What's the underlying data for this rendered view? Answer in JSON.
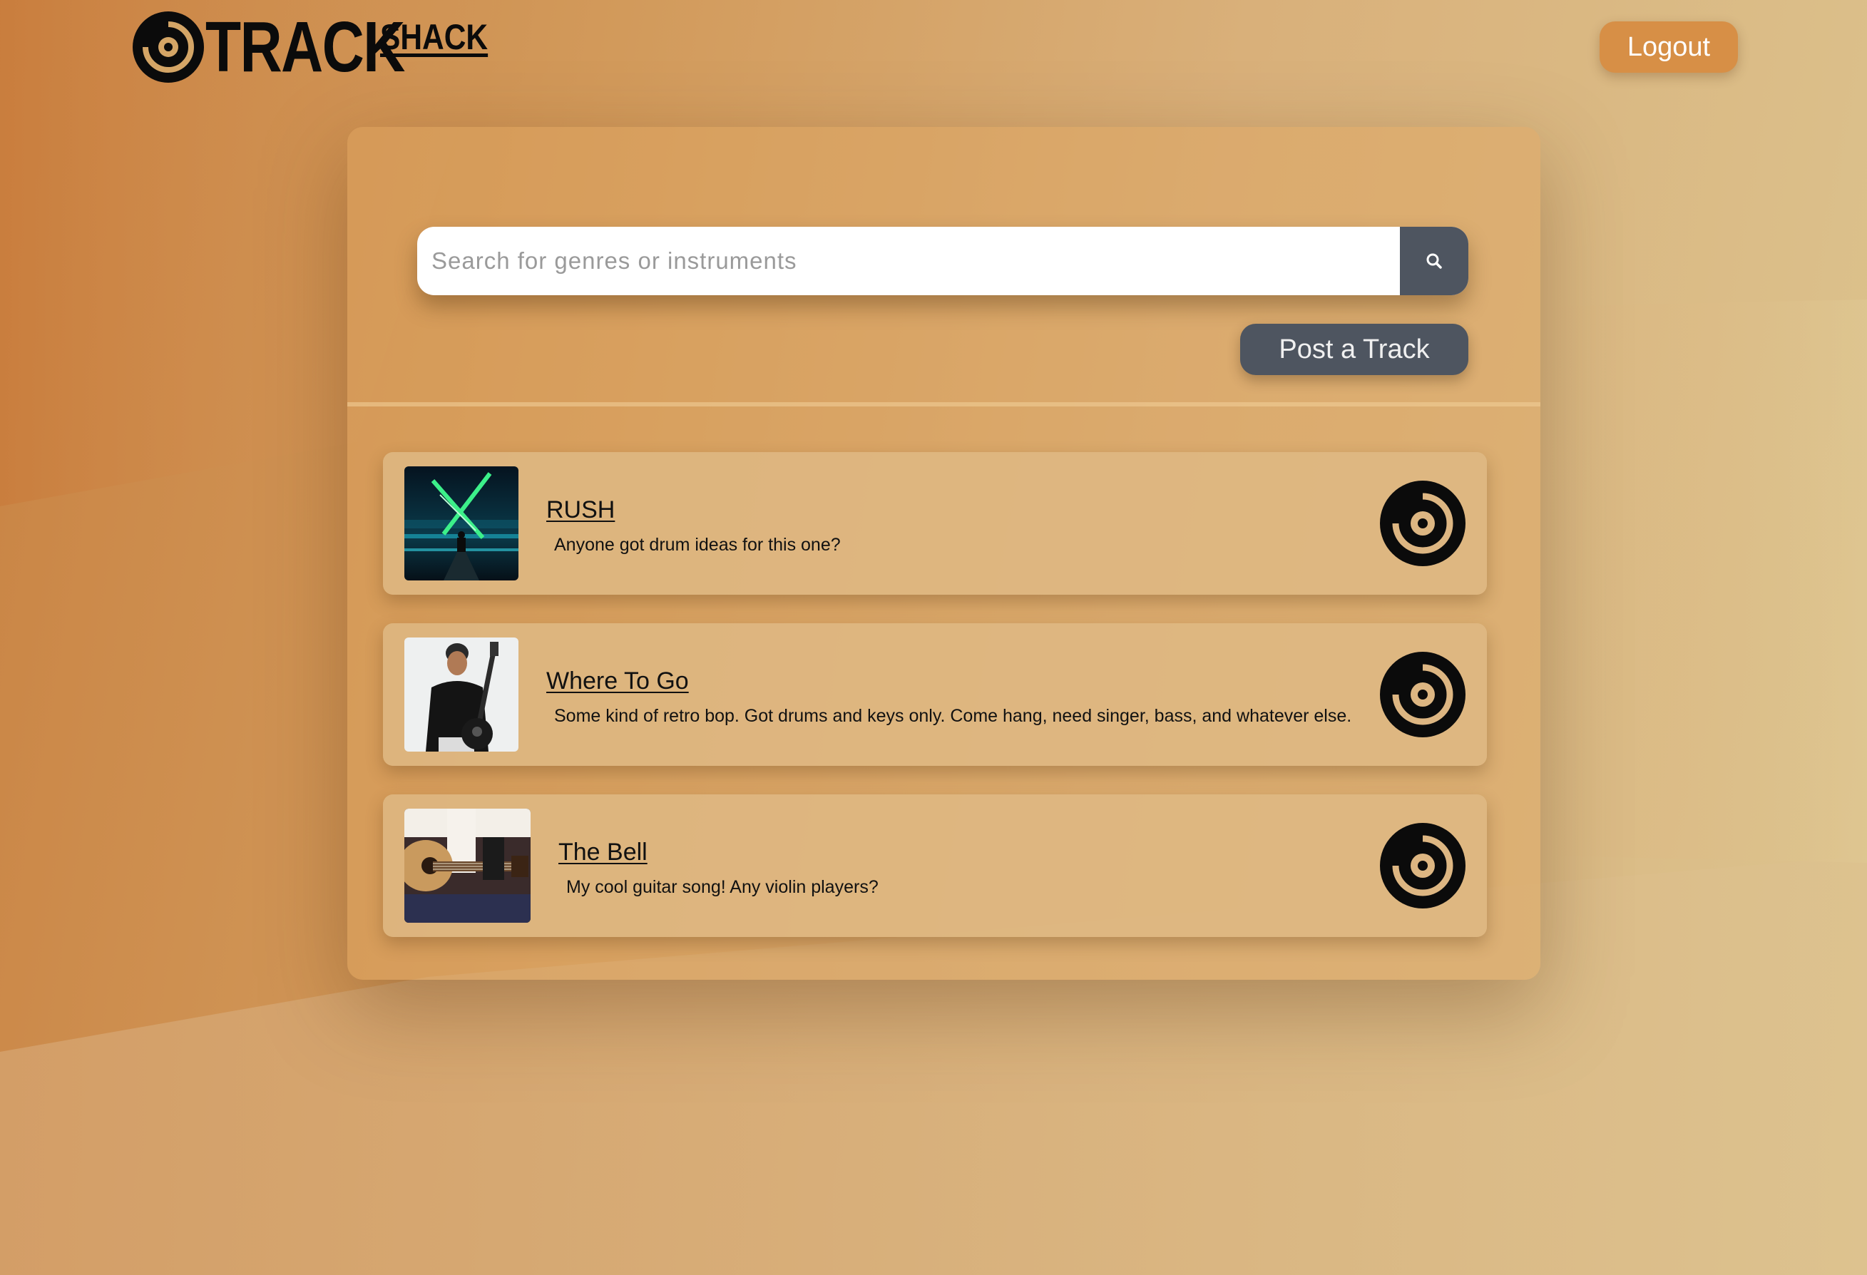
{
  "brand": {
    "logo_primary": "TRACK",
    "logo_secondary": "SHACK"
  },
  "header": {
    "logout_label": "Logout"
  },
  "search": {
    "placeholder": "Search for genres or instruments",
    "value": ""
  },
  "actions": {
    "post_label": "Post a Track"
  },
  "tracks": [
    {
      "title": "RUSH",
      "description": "Anyone got drum ideas for this one?",
      "thumbnail": "neon-crossed-swords-art"
    },
    {
      "title": "Where To Go",
      "description": "Some kind of retro bop. Got drums and keys only. Come hang, need singer, bass, and whatever else.",
      "thumbnail": "man-holding-guitar-photo"
    },
    {
      "title": "The Bell",
      "description": "My cool guitar song! Any violin players?",
      "thumbnail": "acoustic-guitar-closeup-photo"
    }
  ],
  "colors": {
    "accent_orange": "#d78f46",
    "slate_button": "#4e5560",
    "card_bg": "#deb884"
  },
  "icons": {
    "search": "search-icon",
    "play": "vinyl-disc-icon"
  }
}
